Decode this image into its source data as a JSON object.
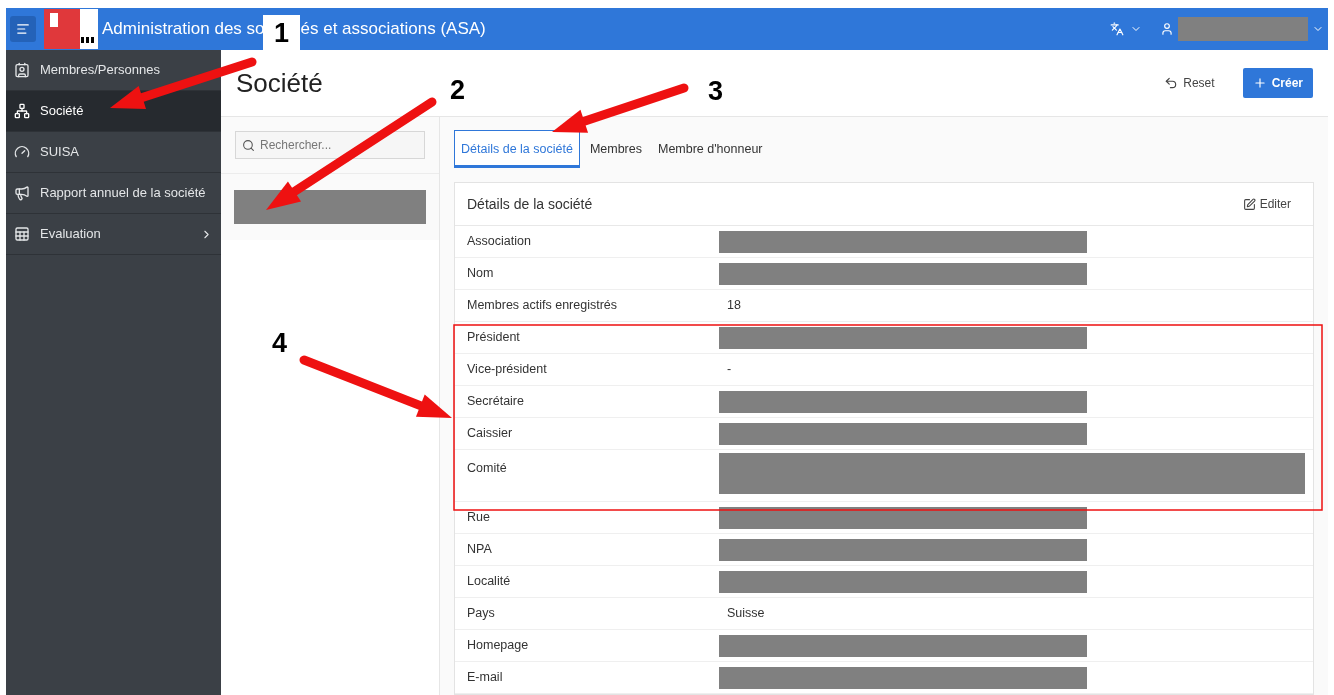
{
  "header": {
    "title_parts": [
      "Administration des so",
      "és et associations (ASA)"
    ]
  },
  "sidebar": {
    "items": [
      {
        "label": "Membres/Personnes",
        "selected": false,
        "has_children": false
      },
      {
        "label": "Société",
        "selected": true,
        "has_children": false
      },
      {
        "label": "SUISA",
        "selected": false,
        "has_children": false
      },
      {
        "label": "Rapport annuel de la société",
        "selected": false,
        "has_children": false
      },
      {
        "label": "Evaluation",
        "selected": false,
        "has_children": true
      }
    ]
  },
  "page": {
    "title": "Société",
    "actions": [
      {
        "label": "Reset",
        "kind": "secondary"
      },
      {
        "label": "Créer",
        "kind": "primary"
      }
    ]
  },
  "search": {
    "placeholder": "Rechercher..."
  },
  "tabs": [
    {
      "label": "Détails de la société",
      "selected": true
    },
    {
      "label": "Membres",
      "selected": false
    },
    {
      "label": "Membre d'honneur",
      "selected": false
    }
  ],
  "card": {
    "title": "Détails de la société",
    "edit_label": "Editer",
    "rows": [
      {
        "label": "Association",
        "kind": "redacted"
      },
      {
        "label": "Nom",
        "kind": "redacted"
      },
      {
        "label": "Membres actifs enregistrés",
        "kind": "text",
        "value": "18"
      },
      {
        "label": "Président",
        "kind": "redacted"
      },
      {
        "label": "Vice-président",
        "kind": "text",
        "value": "-"
      },
      {
        "label": "Secrétaire",
        "kind": "redacted"
      },
      {
        "label": "Caissier",
        "kind": "redacted"
      },
      {
        "label": "Comité",
        "kind": "redacted_wide"
      },
      {
        "label": "Rue",
        "kind": "redacted"
      },
      {
        "label": "NPA",
        "kind": "redacted"
      },
      {
        "label": "Localité",
        "kind": "redacted"
      },
      {
        "label": "Pays",
        "kind": "text",
        "value": "Suisse"
      },
      {
        "label": "Homepage",
        "kind": "redacted"
      },
      {
        "label": "E-mail",
        "kind": "redacted"
      }
    ]
  },
  "annotations": {
    "labels": [
      "1",
      "2",
      "3",
      "4"
    ]
  }
}
